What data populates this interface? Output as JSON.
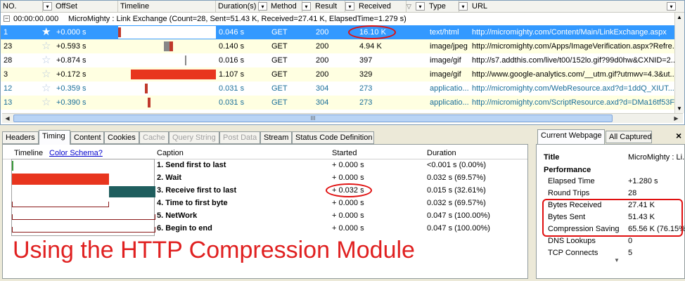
{
  "list": {
    "columns": {
      "no": "NO.",
      "offset": "OffSet",
      "timeline": "Timeline",
      "duration": "Duration(s)",
      "method": "Method",
      "result": "Result",
      "received": "Received",
      "type": "Type",
      "url": "URL"
    },
    "group_row": {
      "time": "00:00:00.000",
      "text": "MicroMighty : Link Exchange  (Count=28, Sent=51.43 K, Received=27.41 K, ElapsedTime=1.279 s)"
    },
    "rows": [
      {
        "no": "1",
        "offset": "+0.000 s",
        "duration": "0.046 s",
        "method": "GET",
        "result": "200",
        "received": "16.10 K",
        "type": "text/html",
        "url": "http://micromighty.com/Content/Main/LinkExchange.aspx"
      },
      {
        "no": "23",
        "offset": "+0.593 s",
        "duration": "0.140 s",
        "method": "GET",
        "result": "200",
        "received": "4.94 K",
        "type": "image/jpeg",
        "url": "http://micromighty.com/Apps/ImageVerification.aspx?Refre..."
      },
      {
        "no": "28",
        "offset": "+0.874 s",
        "duration": "0.016 s",
        "method": "GET",
        "result": "200",
        "received": "397",
        "type": "image/gif",
        "url": "http://s7.addthis.com/live/t00/152lo.gif?99d0hw&CXNID=2..."
      },
      {
        "no": "3",
        "offset": "+0.172 s",
        "duration": "1.107 s",
        "method": "GET",
        "result": "200",
        "received": "329",
        "type": "image/gif",
        "url": "http://www.google-analytics.com/__utm.gif?utmwv=4.3&ut..."
      },
      {
        "no": "12",
        "offset": "+0.359 s",
        "duration": "0.031 s",
        "method": "GET",
        "result": "304",
        "received": "273",
        "type": "applicatio...",
        "url": "http://micromighty.com/WebResource.axd?d=1ddQ_XIUT..."
      },
      {
        "no": "13",
        "offset": "+0.390 s",
        "duration": "0.031 s",
        "method": "GET",
        "result": "304",
        "received": "273",
        "type": "applicatio...",
        "url": "http://micromighty.com/ScriptResource.axd?d=DMa16tf53F..."
      }
    ],
    "scroll_grip": "III"
  },
  "tabs": [
    "Headers",
    "Timing",
    "Content",
    "Cookies",
    "Cache",
    "Query String",
    "Post Data",
    "Stream",
    "Status Code Definition"
  ],
  "timing": {
    "timeline_label": "Timeline",
    "color_schema_link": "Color Schema?",
    "headers": {
      "caption": "Caption",
      "started": "Started",
      "duration": "Duration"
    },
    "rows": [
      {
        "caption": "1.   Send first to last",
        "started": "+ 0.000 s",
        "duration": "<0.001 s  (0.00%)"
      },
      {
        "caption": "2.   Wait",
        "started": "+ 0.000 s",
        "duration": "0.032 s  (69.57%)"
      },
      {
        "caption": "3.   Receive first to last",
        "started": "+ 0.032 s",
        "duration": "0.015 s  (32.61%)"
      },
      {
        "caption": "4.   Time to first byte",
        "started": "+ 0.000 s",
        "duration": "0.032 s  (69.57%)"
      },
      {
        "caption": "5.   NetWork",
        "started": "+ 0.000 s",
        "duration": "0.047 s  (100.00%)"
      },
      {
        "caption": "6.   Begin to end",
        "started": "+ 0.000 s",
        "duration": "0.047 s  (100.00%)"
      }
    ],
    "annotation": "Using the HTTP Compression Module"
  },
  "right_panel": {
    "tabs": [
      "Current Webpage",
      "All Captured"
    ],
    "close": "×",
    "title_label": "Title",
    "title_value": "MicroMighty : Li...",
    "section": "Performance",
    "rows": [
      {
        "label": "Elapsed Time",
        "value": "+1.280 s"
      },
      {
        "label": "Round Trips",
        "value": "28"
      },
      {
        "label": "Bytes Received",
        "value": "27.41 K"
      },
      {
        "label": "Bytes Sent",
        "value": "51.43 K"
      },
      {
        "label": "Compression Saving",
        "value": "65.56 K (76.15%"
      },
      {
        "label": "DNS Lookups",
        "value": "0"
      },
      {
        "label": "TCP Connects",
        "value": "5"
      }
    ]
  },
  "colors": {
    "accent": "#3399ff",
    "annotation": "#e02020",
    "wait_bar": "#e8351e",
    "receive_bar": "#1f5e5e"
  }
}
